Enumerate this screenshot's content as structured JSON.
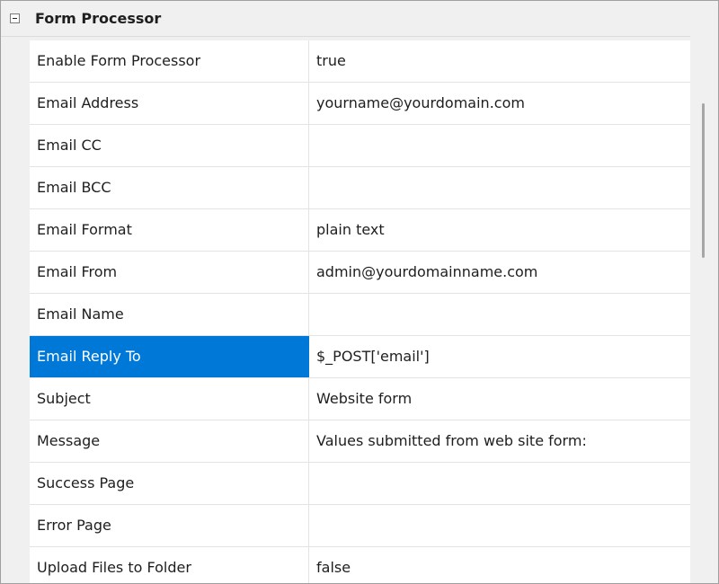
{
  "category": {
    "title": "Form Processor",
    "expanded": true,
    "icon": "collapse-minus-icon"
  },
  "properties": [
    {
      "name": "Enable Form Processor",
      "value": "true"
    },
    {
      "name": "Email Address",
      "value": "yourname@yourdomain.com"
    },
    {
      "name": "Email CC",
      "value": ""
    },
    {
      "name": "Email BCC",
      "value": ""
    },
    {
      "name": "Email Format",
      "value": "plain text"
    },
    {
      "name": "Email From",
      "value": "admin@yourdomainname.com"
    },
    {
      "name": "Email Name",
      "value": ""
    },
    {
      "name": "Email Reply To",
      "value": "$_POST['email']"
    },
    {
      "name": "Subject",
      "value": "Website form"
    },
    {
      "name": "Message",
      "value": "Values submitted from web site form:"
    },
    {
      "name": "Success Page",
      "value": ""
    },
    {
      "name": "Error Page",
      "value": ""
    },
    {
      "name": "Upload Files to Folder",
      "value": "false"
    }
  ],
  "selected_index": 7,
  "colors": {
    "selection": "#0078d7",
    "grid_line": "#e3e3e3",
    "background": "#f0f0f0"
  }
}
